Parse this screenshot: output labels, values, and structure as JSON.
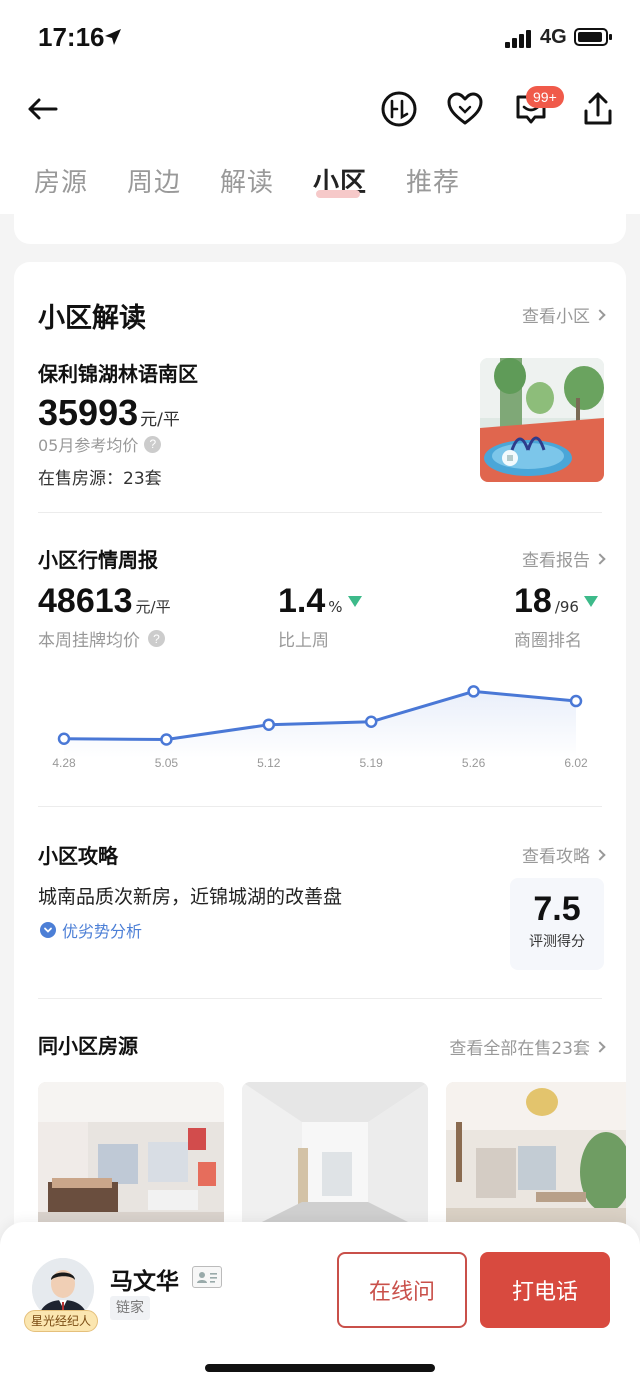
{
  "status": {
    "time": "17:16",
    "network": "4G"
  },
  "badge": "99+",
  "tabs": [
    {
      "label": "房源"
    },
    {
      "label": "周边"
    },
    {
      "label": "解读"
    },
    {
      "label": "小区",
      "active": true
    },
    {
      "label": "推荐"
    }
  ],
  "community": {
    "section_title": "小区解读",
    "view_link": "查看小区",
    "name": "保利锦湖林语南区",
    "price": "35993",
    "price_unit": "元/平",
    "price_note": "05月参考均价",
    "on_sale": "在售房源：23套"
  },
  "weekly": {
    "title": "小区行情周报",
    "view_link": "查看报告",
    "avg_price": "48613",
    "avg_unit": "元/平",
    "avg_label": "本周挂牌均价",
    "change": "1.4",
    "change_unit": "%",
    "change_label": "比上周",
    "rank": "18",
    "rank_total": "/96",
    "rank_label": "商圈排名",
    "change_color": "#3dba8a"
  },
  "chart_data": {
    "type": "line",
    "x": [
      "4.28",
      "5.05",
      "5.12",
      "5.19",
      "5.26",
      "6.02"
    ],
    "values": [
      0.26,
      0.25,
      0.45,
      0.49,
      0.9,
      0.77
    ],
    "color": "#4a78d6"
  },
  "guide": {
    "title": "小区攻略",
    "view_link": "查看攻略",
    "text": "城南品质次新房，近锦城湖的改善盘",
    "tag": "优劣势分析",
    "score": "7.5",
    "score_label": "评测得分"
  },
  "same": {
    "title": "同小区房源",
    "view_link": "查看全部在售23套"
  },
  "agent": {
    "name": "马文华",
    "company": "链家",
    "tag": "星光经纪人",
    "online_btn": "在线问",
    "call_btn": "打电话"
  }
}
